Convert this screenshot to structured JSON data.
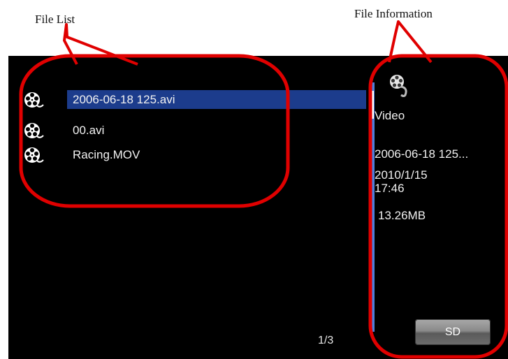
{
  "captions": {
    "file_list": "File List",
    "file_information": "File Information"
  },
  "files": [
    {
      "name": "2006-06-18 125.avi",
      "icon": "video-reel-icon",
      "selected": true
    },
    {
      "name": "00.avi",
      "icon": "video-reel-icon",
      "selected": false
    },
    {
      "name": "Racing.MOV",
      "icon": "video-reel-icon",
      "selected": false
    }
  ],
  "page_indicator": "1/3",
  "info": {
    "icon": "film-reel-icon",
    "type": "Video",
    "name": "2006-06-18 125...",
    "date": "2010/1/15",
    "time": "17:46",
    "size": "13.26MB"
  },
  "source_button": "SD",
  "colors": {
    "screen_bg": "#000000",
    "selection": "#1c3c8c",
    "scrollbar": "#4f7fdc",
    "annotation": "#e00000"
  }
}
